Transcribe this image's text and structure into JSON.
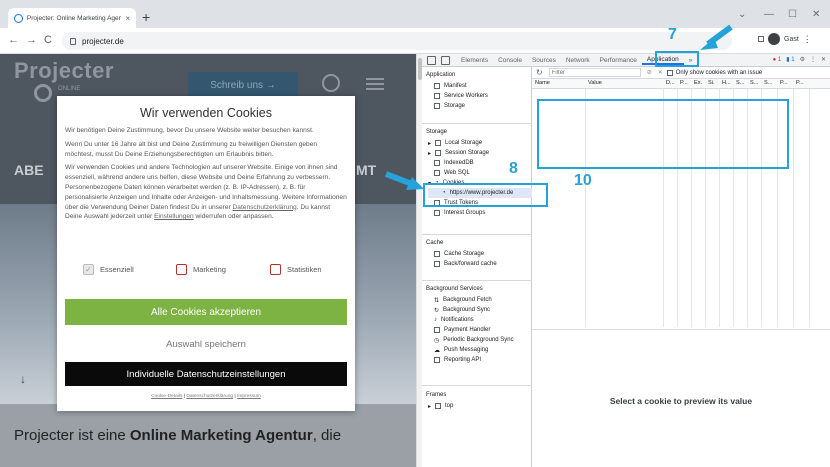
{
  "browser": {
    "tab_title": "Projecter: Online Marketing Agentur",
    "tab_close": "×",
    "new_tab": "+",
    "url": "projecter.de",
    "profile_label": "Gast",
    "minimize": "—",
    "maximize": "☐",
    "close": "✕",
    "back": "←",
    "forward": "→",
    "reload": "C",
    "menu": "⋮"
  },
  "website": {
    "logo": "Projecter",
    "logo_sub": "ONLINE",
    "cta": "Schreib uns  →",
    "hero_left": "ABE",
    "hero_right": "MT",
    "scroll_arrow": "↓",
    "intro_pre": "Projecter ist eine ",
    "intro_bold": "Online Marketing Agentur",
    "intro_post": ", die"
  },
  "cookie_modal": {
    "title": "Wir verwenden Cookies",
    "p1": "Wir benötigen Deine Zustimmung, bevor Du unsere Website weiter besuchen kannst.",
    "p2": "Wenn Du unter 16 Jahre alt bist und Deine Zustimmung zu freiwilligen Diensten geben möchtest, musst Du Deine Erziehungsberechtigten um Erlaubnis bitten.",
    "p3_a": "Wir verwenden Cookies und andere Technologien auf unserer Website. Einige von ihnen sind essenziell, während andere uns helfen, diese Website und Deine Erfahrung zu verbessern. Personenbezogene Daten können verarbeitet werden (z. B. IP-Adressen), z. B. für personalisierte Anzeigen und Inhalte oder Anzeigen- und Inhaltsmessung. Weitere Informationen über die Verwendung Deiner Daten findest Du in unserer ",
    "p3_link1": "Datenschutzerklärung",
    "p3_b": ". Du kannst Deine Auswahl jederzeit unter ",
    "p3_link2": "Einstellungen",
    "p3_c": " widerrufen oder anpassen.",
    "opt_essential": "Essenziell",
    "opt_marketing": "Marketing",
    "opt_statistics": "Statistiken",
    "checkmark": "✓",
    "accept_all": "Alle Cookies akzeptieren",
    "save_selection": "Auswahl speichern",
    "individual": "Individuelle Datenschutzeinstellungen",
    "foot_details": "Cookie-Details",
    "foot_privacy": "Datenschutzerklärung",
    "foot_imprint": "Impressum",
    "foot_sep": " | "
  },
  "devtools": {
    "tabs": [
      "Elements",
      "Console",
      "Sources",
      "Network",
      "Performance",
      "Application"
    ],
    "more": "»",
    "errors": "● 1",
    "messages": "▮ 1",
    "settings": "⚙",
    "menu": "⋮",
    "close": "✕",
    "sidebar": {
      "application_title": "Application",
      "application_items": [
        "Manifest",
        "Service Workers",
        "Storage"
      ],
      "storage_title": "Storage",
      "storage_items": [
        "Local Storage",
        "Session Storage",
        "IndexedDB",
        "Web SQL",
        "Cookies",
        "https://www.projecter.de",
        "Trust Tokens",
        "Interest Groups"
      ],
      "cache_title": "Cache",
      "cache_items": [
        "Cache Storage",
        "Back/forward cache"
      ],
      "bg_title": "Background Services",
      "bg_items": [
        "Background Fetch",
        "Background Sync",
        "Notifications",
        "Payment Handler",
        "Periodic Background Sync",
        "Push Messaging",
        "Reporting API"
      ],
      "frames_title": "Frames",
      "frames_items": [
        "top"
      ]
    },
    "filter_placeholder": "Filter",
    "only_issue_label": "Only show cookies with an issue",
    "columns": [
      "Name",
      "Value",
      "D...",
      "P...",
      "Ex.",
      "Si.",
      "H...",
      "S...",
      "S...",
      "S...",
      "P...",
      "P..."
    ],
    "preview_text": "Select a cookie to preview its value"
  },
  "annotations": {
    "n7": "7",
    "n8": "8",
    "n10": "10",
    "color": "#25a3d8"
  }
}
